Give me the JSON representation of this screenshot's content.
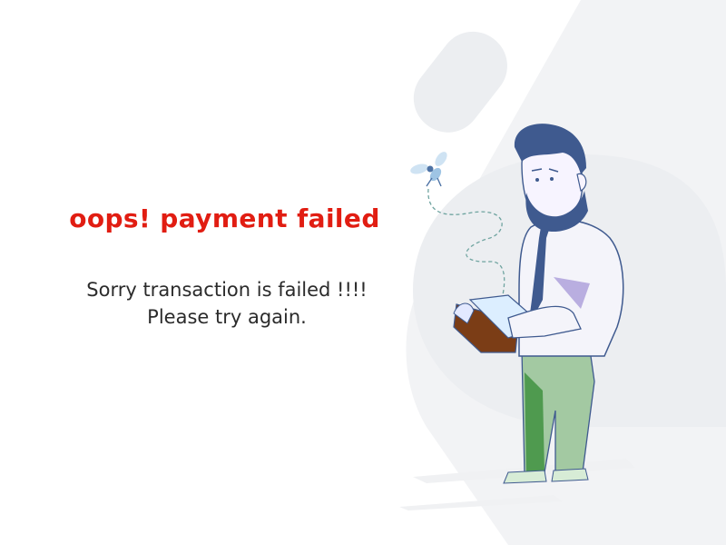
{
  "title": "oops! payment failed",
  "message": {
    "line1": "Sorry transaction is failed !!!!",
    "line2": "Please try again."
  },
  "colors": {
    "title": "#e11d12",
    "text": "#2b2b2b",
    "background_shape": "#f2f3f5",
    "hair": "#3f5a8f",
    "pants": "#a3c9a2",
    "wallet": "#7b3d16"
  },
  "illustration": {
    "subject": "sad-man-with-empty-wallet",
    "insect": "mosquito"
  }
}
